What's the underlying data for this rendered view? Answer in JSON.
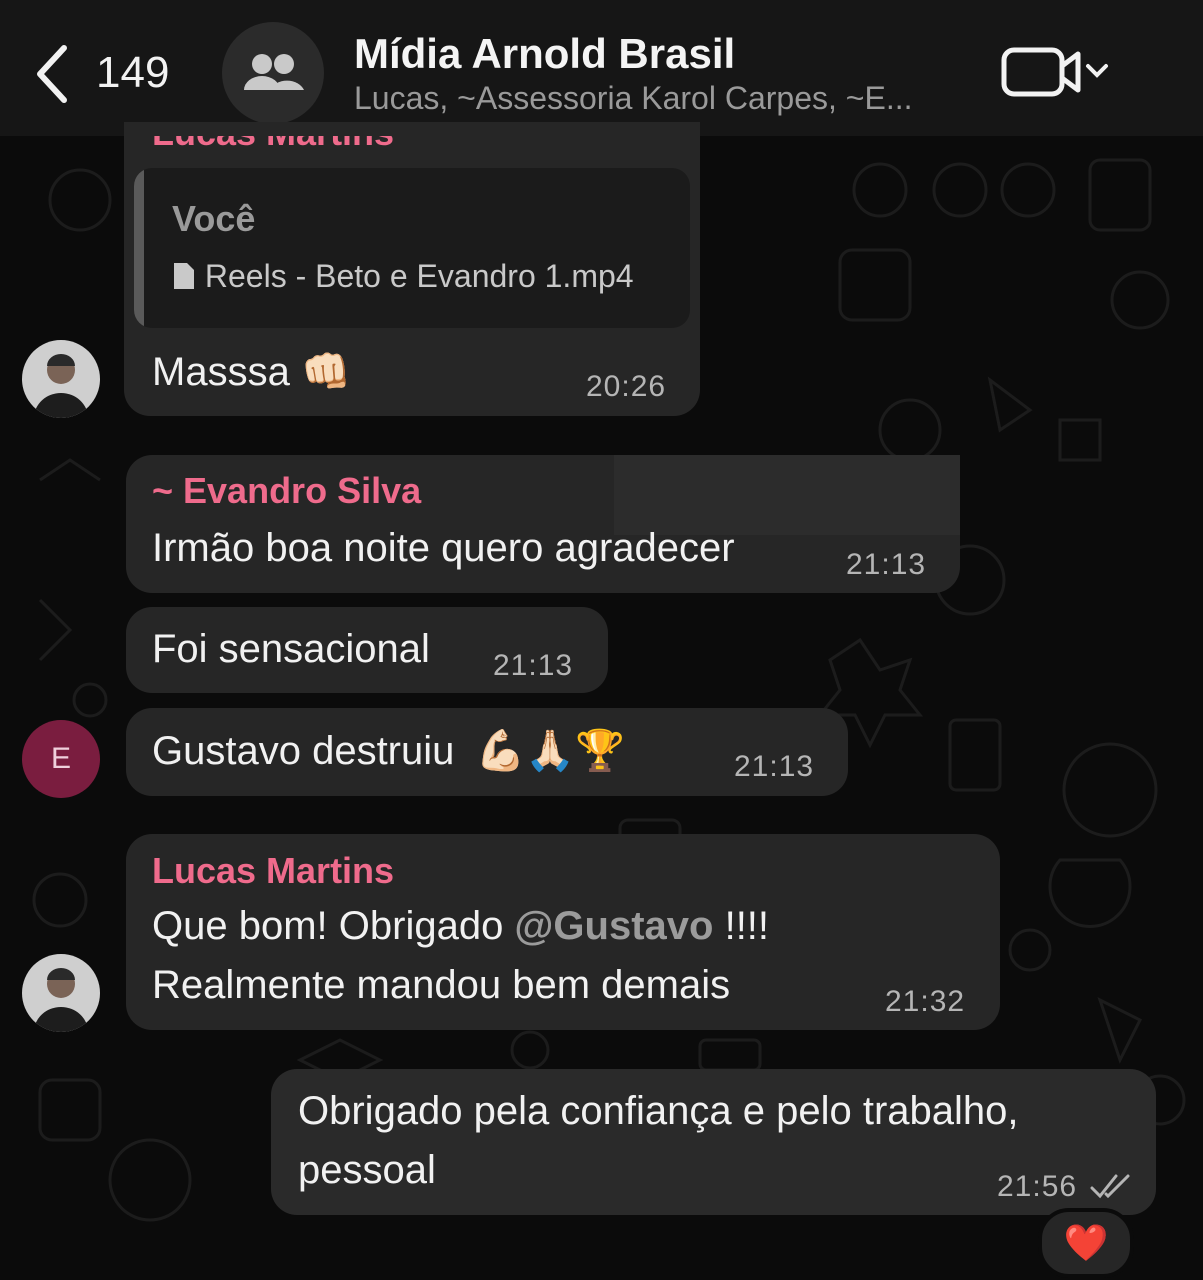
{
  "header": {
    "back_count": "149",
    "title": "Mídia Arnold Brasil",
    "subtitle": "Lucas, ~Assessoria Karol Carpes, ~E..."
  },
  "messages": [
    {
      "sender": "Lucas Martins",
      "quote_author": "Você",
      "quote_file": "Reels - Beto e Evandro 1.mp4",
      "text": "Masssa",
      "emoji": "👊🏻",
      "time": "20:26"
    },
    {
      "sender": "~ Evandro Silva",
      "text": "Irmão boa noite quero agradecer",
      "time": "21:13"
    },
    {
      "text": "Foi sensacional",
      "time": "21:13"
    },
    {
      "avatar_letter": "E",
      "text": "Gustavo destruiu",
      "emoji": "💪🏻🙏🏻🏆",
      "time": "21:13"
    },
    {
      "sender": "Lucas Martins",
      "line1_prefix": "Que bom! Obrigado ",
      "mention": "@Gustavo",
      "line1_suffix": " !!!!",
      "line2": "Realmente mandou bem demais",
      "time": "21:32"
    },
    {
      "line1": "Obrigado pela confiança e pelo trabalho,",
      "line2": "pessoal",
      "time": "21:56",
      "reaction": "❤️"
    }
  ],
  "colors": {
    "background": "#0b0b0b",
    "header": "#161616",
    "bubble": "#262626",
    "sender_name": "#ef6b8c",
    "avatar_e": "#7a1d3f"
  },
  "icons": [
    "chevron-left-icon",
    "group-icon",
    "video-call-icon",
    "chevron-down-icon",
    "file-icon",
    "double-check-icon"
  ]
}
